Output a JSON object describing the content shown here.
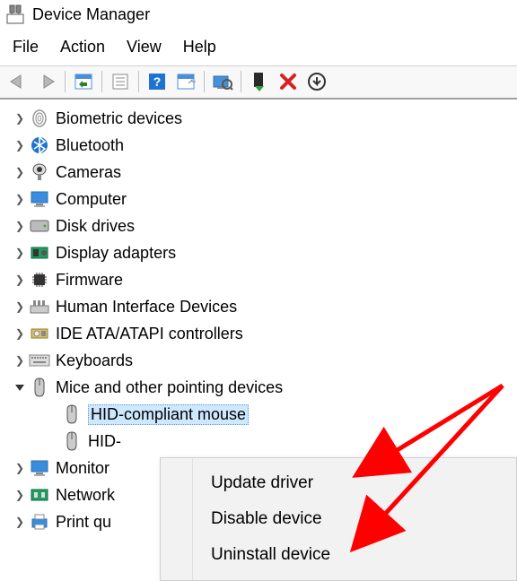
{
  "window": {
    "title": "Device Manager"
  },
  "menubar": {
    "file": "File",
    "action": "Action",
    "view": "View",
    "help": "Help"
  },
  "tree": {
    "items": [
      {
        "name": "biometric",
        "label": "Biometric devices",
        "icon": "fingerprint-icon",
        "expanded": false
      },
      {
        "name": "bluetooth",
        "label": "Bluetooth",
        "icon": "bluetooth-icon",
        "expanded": false
      },
      {
        "name": "cameras",
        "label": "Cameras",
        "icon": "camera-icon",
        "expanded": false
      },
      {
        "name": "computer",
        "label": "Computer",
        "icon": "monitor-icon",
        "expanded": false
      },
      {
        "name": "disk",
        "label": "Disk drives",
        "icon": "disk-icon",
        "expanded": false
      },
      {
        "name": "display",
        "label": "Display adapters",
        "icon": "gpu-icon",
        "expanded": false
      },
      {
        "name": "firmware",
        "label": "Firmware",
        "icon": "chip-icon",
        "expanded": false
      },
      {
        "name": "hid",
        "label": "Human Interface Devices",
        "icon": "hid-icon",
        "expanded": false
      },
      {
        "name": "ide",
        "label": "IDE ATA/ATAPI controllers",
        "icon": "ide-icon",
        "expanded": false
      },
      {
        "name": "keyboards",
        "label": "Keyboards",
        "icon": "keyboard-icon",
        "expanded": false
      },
      {
        "name": "mice",
        "label": "Mice and other pointing devices",
        "icon": "mouse-icon",
        "expanded": true,
        "children": [
          {
            "name": "mouse1",
            "label": "HID-compliant mouse",
            "selected": true
          },
          {
            "name": "mouse2",
            "label": "HID-",
            "selected": false
          }
        ]
      },
      {
        "name": "monitors",
        "label": "Monitor",
        "icon": "monitor-icon",
        "expanded": false,
        "truncated": true
      },
      {
        "name": "network",
        "label": "Network",
        "icon": "network-icon",
        "expanded": false,
        "truncated": true
      },
      {
        "name": "printq",
        "label": "Print qu",
        "icon": "printer-icon",
        "expanded": false,
        "truncated": true
      }
    ]
  },
  "context_menu": {
    "items": [
      {
        "name": "update-driver",
        "label": "Update driver"
      },
      {
        "name": "disable-device",
        "label": "Disable device"
      },
      {
        "name": "uninstall-device",
        "label": "Uninstall device"
      }
    ]
  },
  "annotations": {
    "arrow_color": "#ff0000"
  }
}
